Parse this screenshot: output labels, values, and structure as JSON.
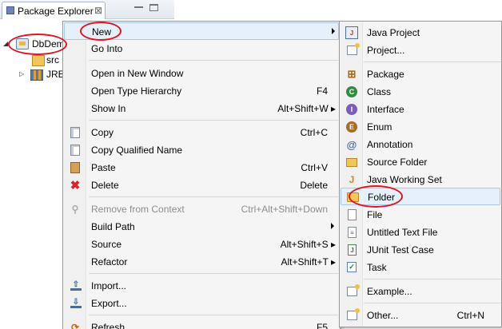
{
  "view": {
    "tab_label": "Package Explorer",
    "close_glyph": "⊠"
  },
  "tree": {
    "project": "DbDemo",
    "src": "src",
    "jre": "JRE"
  },
  "context_menu": {
    "items": [
      {
        "label": "New",
        "accelerator": ""
      },
      {
        "label": "Go Into",
        "accelerator": ""
      },
      {
        "label": "Open in New Window",
        "accelerator": ""
      },
      {
        "label": "Open Type Hierarchy",
        "accelerator": "F4"
      },
      {
        "label": "Show In",
        "accelerator": "Alt+Shift+W ▸"
      },
      {
        "label": "Copy",
        "accelerator": "Ctrl+C"
      },
      {
        "label": "Copy Qualified Name",
        "accelerator": ""
      },
      {
        "label": "Paste",
        "accelerator": "Ctrl+V"
      },
      {
        "label": "Delete",
        "accelerator": "Delete"
      },
      {
        "label": "Remove from Context",
        "accelerator": "Ctrl+Alt+Shift+Down"
      },
      {
        "label": "Build Path",
        "accelerator": ""
      },
      {
        "label": "Source",
        "accelerator": "Alt+Shift+S ▸"
      },
      {
        "label": "Refactor",
        "accelerator": "Alt+Shift+T ▸"
      },
      {
        "label": "Import...",
        "accelerator": ""
      },
      {
        "label": "Export...",
        "accelerator": ""
      },
      {
        "label": "Refresh",
        "accelerator": "F5"
      }
    ]
  },
  "new_submenu": {
    "items": [
      {
        "label": "Java Project",
        "accelerator": ""
      },
      {
        "label": "Project...",
        "accelerator": ""
      },
      {
        "label": "Package",
        "accelerator": ""
      },
      {
        "label": "Class",
        "accelerator": ""
      },
      {
        "label": "Interface",
        "accelerator": ""
      },
      {
        "label": "Enum",
        "accelerator": ""
      },
      {
        "label": "Annotation",
        "accelerator": ""
      },
      {
        "label": "Source Folder",
        "accelerator": ""
      },
      {
        "label": "Java Working Set",
        "accelerator": ""
      },
      {
        "label": "Folder",
        "accelerator": ""
      },
      {
        "label": "File",
        "accelerator": ""
      },
      {
        "label": "Untitled Text File",
        "accelerator": ""
      },
      {
        "label": "JUnit Test Case",
        "accelerator": ""
      },
      {
        "label": "Task",
        "accelerator": ""
      },
      {
        "label": "Example...",
        "accelerator": ""
      },
      {
        "label": "Other...",
        "accelerator": "Ctrl+N"
      }
    ]
  },
  "annotation_color": "#e0151f",
  "highlight_color": "#e6f0fa"
}
